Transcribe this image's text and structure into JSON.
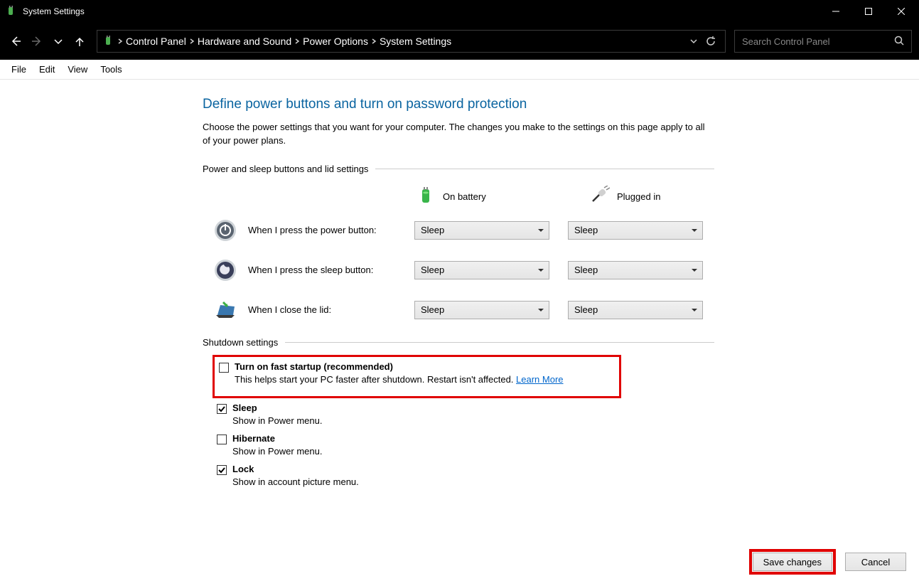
{
  "window": {
    "title": "System Settings"
  },
  "breadcrumbs": {
    "items": [
      "Control Panel",
      "Hardware and Sound",
      "Power Options",
      "System Settings"
    ]
  },
  "search": {
    "placeholder": "Search Control Panel"
  },
  "menu": {
    "file": "File",
    "edit": "Edit",
    "view": "View",
    "tools": "Tools"
  },
  "page": {
    "title": "Define power buttons and turn on password protection",
    "description": "Choose the power settings that you want for your computer. The changes you make to the settings on this page apply to all of your power plans."
  },
  "section1": {
    "label": "Power and sleep buttons and lid settings",
    "mode_battery": "On battery",
    "mode_plugged": "Plugged in",
    "rows": {
      "power": {
        "label": "When I press the power button:",
        "battery": "Sleep",
        "plugged": "Sleep"
      },
      "sleep": {
        "label": "When I press the sleep button:",
        "battery": "Sleep",
        "plugged": "Sleep"
      },
      "lid": {
        "label": "When I close the lid:",
        "battery": "Sleep",
        "plugged": "Sleep"
      }
    }
  },
  "section2": {
    "label": "Shutdown settings",
    "fast_startup": {
      "label": "Turn on fast startup (recommended)",
      "desc": "This helps start your PC faster after shutdown. Restart isn't affected. ",
      "link": "Learn More",
      "checked": false
    },
    "sleep": {
      "label": "Sleep",
      "desc": "Show in Power menu.",
      "checked": true
    },
    "hibernate": {
      "label": "Hibernate",
      "desc": "Show in Power menu.",
      "checked": false
    },
    "lock": {
      "label": "Lock",
      "desc": "Show in account picture menu.",
      "checked": true
    }
  },
  "footer": {
    "save": "Save changes",
    "cancel": "Cancel"
  }
}
